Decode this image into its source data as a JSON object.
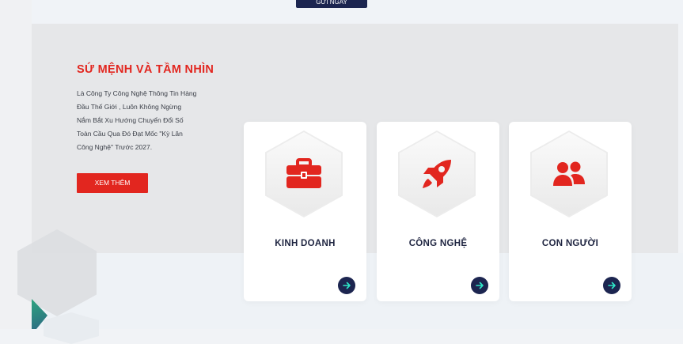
{
  "top_button": {
    "label": "GỬI NGAY"
  },
  "mission": {
    "title": "SỨ MỆNH VÀ TẦM NHÌN",
    "description_lines": [
      "Là Công Ty Công Nghệ Thông Tin Hàng",
      "Đầu Thế Giới , Luôn Không Ngừng",
      "Nắm Bắt Xu Hướng Chuyển Đổi Số",
      "Toàn Cầu Qua Đó Đạt Mốc \"Kỳ Lân",
      "Công Nghệ\" Trước 2027."
    ],
    "button_label": "XEM THÊM"
  },
  "cards": [
    {
      "label": "KINH DOANH",
      "icon": "briefcase-icon"
    },
    {
      "label": "CÔNG NGHỆ",
      "icon": "rocket-icon"
    },
    {
      "label": "CON NGƯỜI",
      "icon": "users-icon"
    }
  ],
  "colors": {
    "accent": "#e2261f",
    "navy": "#1c2550",
    "icon_arrow": "#2ee6c8"
  }
}
